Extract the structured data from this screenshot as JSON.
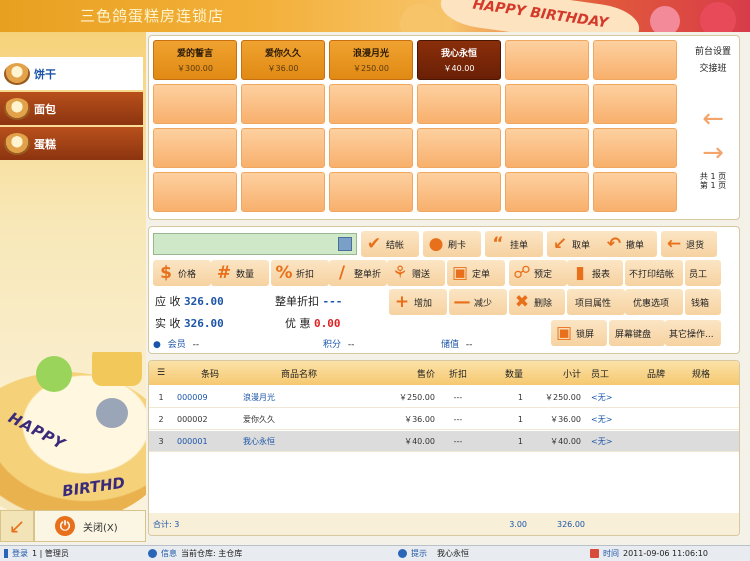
{
  "app": {
    "title": "三色鸽蛋糕房连锁店",
    "banner_art": "HAPPY BIRTHDAY"
  },
  "colors": {
    "accent": "#e8701a",
    "tile": "#f8b06c",
    "tile_filled": "#e08a14",
    "tile_selected": "#6a2006",
    "link": "#1b55a8"
  },
  "sidebar": {
    "categories": [
      {
        "label": "饼干",
        "icon": "cookie-icon",
        "active": true
      },
      {
        "label": "面包",
        "icon": "bread-icon",
        "active": false
      },
      {
        "label": "蛋糕",
        "icon": "cake-icon",
        "active": false
      }
    ],
    "cake_art": "HAPPY BIRTHDAY",
    "close_label": "关闭(X)"
  },
  "products": [
    {
      "name": "爱的誓言",
      "price": "￥300.00",
      "state": "filled"
    },
    {
      "name": "爱你久久",
      "price": "￥36.00",
      "state": "filled"
    },
    {
      "name": "浪漫月光",
      "price": "￥250.00",
      "state": "filled"
    },
    {
      "name": "我心永恒",
      "price": "￥40.00",
      "state": "selected"
    }
  ],
  "side": {
    "settings": "前台设置",
    "shift": "交接班",
    "page_total": "共 1 页",
    "page_current": "第 1 页"
  },
  "actions": {
    "checkout": "结帐",
    "card": "刷卡",
    "hold": "挂单",
    "fetch": "取单",
    "undo": "撤单",
    "refund": "退货",
    "price": "价格",
    "qty": "数量",
    "discount": "折扣",
    "order_disc": "整单折",
    "gift": "赠送",
    "order": "定单",
    "reserve": "预定",
    "report": "报表",
    "no_print": "不打印结帐",
    "staff": "员工",
    "add": "增加",
    "reduce": "减少",
    "delete": "删除",
    "item_attr": "项目属性",
    "promo": "优惠选项",
    "cashbox": "钱箱",
    "lock": "锁屏",
    "screen_kb": "屏幕键盘",
    "other": "其它操作..."
  },
  "summary": {
    "receivable_label": "应 收",
    "receivable": "326.00",
    "order_disc_label": "整单折扣",
    "order_disc": "---",
    "received_label": "实 收",
    "received": "326.00",
    "offer_label": "优 惠",
    "offer": "0.00",
    "member_label": "会员",
    "member": "--",
    "points_label": "积分",
    "points": "--",
    "stored_label": "储值",
    "stored": "--"
  },
  "table": {
    "headers": [
      "条码",
      "商品名称",
      "售价",
      "折扣",
      "数量",
      "小计",
      "员工",
      "品牌",
      "规格"
    ],
    "rows": [
      {
        "no": "1",
        "code": "000009",
        "name": "浪漫月光",
        "price": "￥250.00",
        "disc": "---",
        "qty": "1",
        "subtotal": "￥250.00",
        "staff": "<无>",
        "selected": false,
        "blue": true
      },
      {
        "no": "2",
        "code": "000002",
        "name": "爱你久久",
        "price": "￥36.00",
        "disc": "---",
        "qty": "1",
        "subtotal": "￥36.00",
        "staff": "<无>",
        "selected": false,
        "blue": false
      },
      {
        "no": "3",
        "code": "000001",
        "name": "我心永恒",
        "price": "￥40.00",
        "disc": "---",
        "qty": "1",
        "subtotal": "￥40.00",
        "staff": "<无>",
        "selected": true,
        "blue": true
      }
    ],
    "footer": {
      "label": "合计: 3",
      "qty": "3.00",
      "total": "326.00"
    }
  },
  "status": {
    "login_label": "登录",
    "login_value": "1 | 管理员",
    "info_label": "信息",
    "warehouse": "当前仓库: 主仓库",
    "tip_label": "提示",
    "tip_value": "我心永恒",
    "time_label": "时间",
    "time_value": "2011-09-06 11:06:10"
  }
}
